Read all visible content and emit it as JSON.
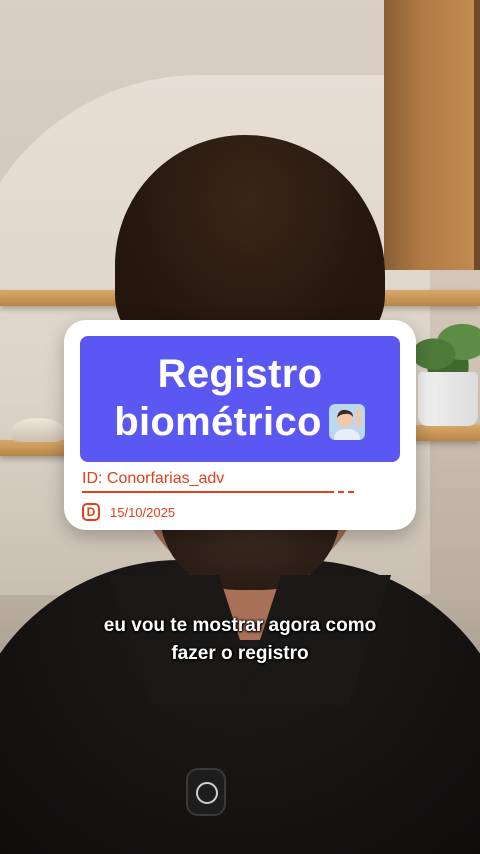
{
  "card": {
    "title_line1": "Registro",
    "title_line2": "biométrico",
    "title_emoji": "man-raising-hand-emoji",
    "id_label": "ID: Conorfarias_adv",
    "date_icon_letter": "D",
    "date": "15/10/2025",
    "accent_color": "#5b57f2",
    "text_accent_color": "#e0401a"
  },
  "caption": {
    "line1": "eu vou te mostrar agora como",
    "line2": "fazer o registro"
  }
}
